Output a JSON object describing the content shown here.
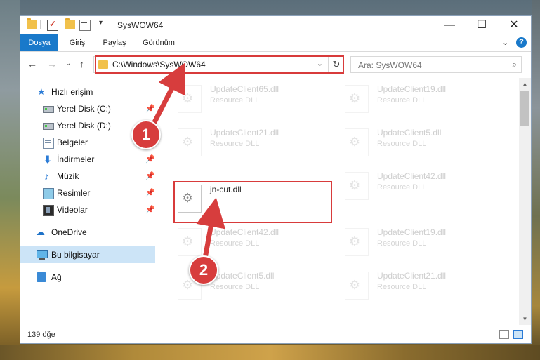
{
  "window": {
    "title": "SysWOW64"
  },
  "title_buttons": {
    "minimize": "—",
    "maximize": "☐",
    "close": "✕"
  },
  "ribbon": {
    "tabs": [
      "Dosya",
      "Giriş",
      "Paylaş",
      "Görünüm"
    ],
    "active_tab": "Dosya",
    "help": "?"
  },
  "nav": {
    "address": "C:\\Windows\\SysWOW64",
    "search_placeholder": "Ara: SysWOW64"
  },
  "sidebar": {
    "items": [
      {
        "label": "Hızlı erişim",
        "icon": "star-icon"
      },
      {
        "label": "Yerel Disk (C:)",
        "icon": "drive-icon",
        "pinned": true
      },
      {
        "label": "Yerel Disk (D:)",
        "icon": "drive-icon",
        "pinned": false
      },
      {
        "label": "Belgeler",
        "icon": "documents-icon",
        "pinned": true
      },
      {
        "label": "İndirmeler",
        "icon": "downloads-icon",
        "pinned": true
      },
      {
        "label": "Müzik",
        "icon": "music-icon",
        "pinned": true
      },
      {
        "label": "Resimler",
        "icon": "pictures-icon",
        "pinned": true
      },
      {
        "label": "Videolar",
        "icon": "videos-icon",
        "pinned": true
      },
      {
        "label": "OneDrive",
        "icon": "cloud-icon"
      },
      {
        "label": "Bu bilgisayar",
        "icon": "computer-icon",
        "selected": true
      },
      {
        "label": "Ağ",
        "icon": "network-icon"
      }
    ]
  },
  "files": [
    {
      "name": "UpdateClient65.dll",
      "desc": "Resource DLL"
    },
    {
      "name": "UpdateClient19.dll",
      "desc": "Resource DLL"
    },
    {
      "name": "UpdateClient21.dll",
      "desc": "Resource DLL"
    },
    {
      "name": "UpdateClient5.dll",
      "desc": "Resource DLL"
    },
    {
      "name": "jn-cut.dll",
      "desc": ""
    },
    {
      "name": "UpdateClient42.dll",
      "desc": "Resource DLL"
    },
    {
      "name": "UpdateClient42.dll",
      "desc": "Resource DLL"
    },
    {
      "name": "UpdateClient19.dll",
      "desc": "Resource DLL"
    },
    {
      "name": "UpdateClient5.dll",
      "desc": "Resource DLL"
    },
    {
      "name": "UpdateClient21.dll",
      "desc": "Resource DLL"
    }
  ],
  "status": {
    "item_count": "139 öğe"
  },
  "annotations": {
    "step1": "1",
    "step2": "2",
    "highlight_color": "#d83b3b"
  }
}
